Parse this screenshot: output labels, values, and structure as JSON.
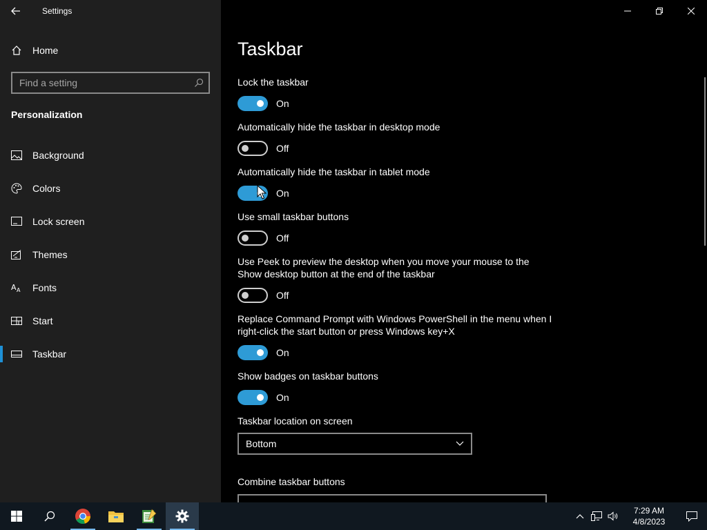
{
  "window": {
    "title": "Settings"
  },
  "sidebar": {
    "home_label": "Home",
    "search_placeholder": "Find a setting",
    "section_title": "Personalization",
    "items": [
      {
        "label": "Background",
        "icon": "background-icon"
      },
      {
        "label": "Colors",
        "icon": "colors-palette-icon"
      },
      {
        "label": "Lock screen",
        "icon": "lock-screen-icon"
      },
      {
        "label": "Themes",
        "icon": "themes-icon"
      },
      {
        "label": "Fonts",
        "icon": "fonts-icon"
      },
      {
        "label": "Start",
        "icon": "start-icon"
      },
      {
        "label": "Taskbar",
        "icon": "taskbar-icon",
        "active": true
      }
    ]
  },
  "main": {
    "title": "Taskbar",
    "settings": [
      {
        "label": "Lock the taskbar",
        "state": "On",
        "on": true
      },
      {
        "label": "Automatically hide the taskbar in desktop mode",
        "state": "Off",
        "on": false
      },
      {
        "label": "Automatically hide the taskbar in tablet mode",
        "state": "On",
        "on": true
      },
      {
        "label": "Use small taskbar buttons",
        "state": "Off",
        "on": false
      },
      {
        "label": "Use Peek to preview the desktop when you move your mouse to the Show desktop button at the end of the taskbar",
        "state": "Off",
        "on": false
      },
      {
        "label": "Replace Command Prompt with Windows PowerShell in the menu when I right-click the start button or press Windows key+X",
        "state": "On",
        "on": true
      },
      {
        "label": "Show badges on taskbar buttons",
        "state": "On",
        "on": true
      }
    ],
    "location_label": "Taskbar location on screen",
    "location_value": "Bottom",
    "combine_label": "Combine taskbar buttons"
  },
  "taskbar": {
    "clock_time": "7:29 AM",
    "clock_date": "4/8/2023"
  },
  "colors": {
    "accent": "#2e9bd6",
    "sidebar_bg": "#1f1f1f",
    "main_bg": "#000000",
    "taskbar_bg": "#101820"
  }
}
